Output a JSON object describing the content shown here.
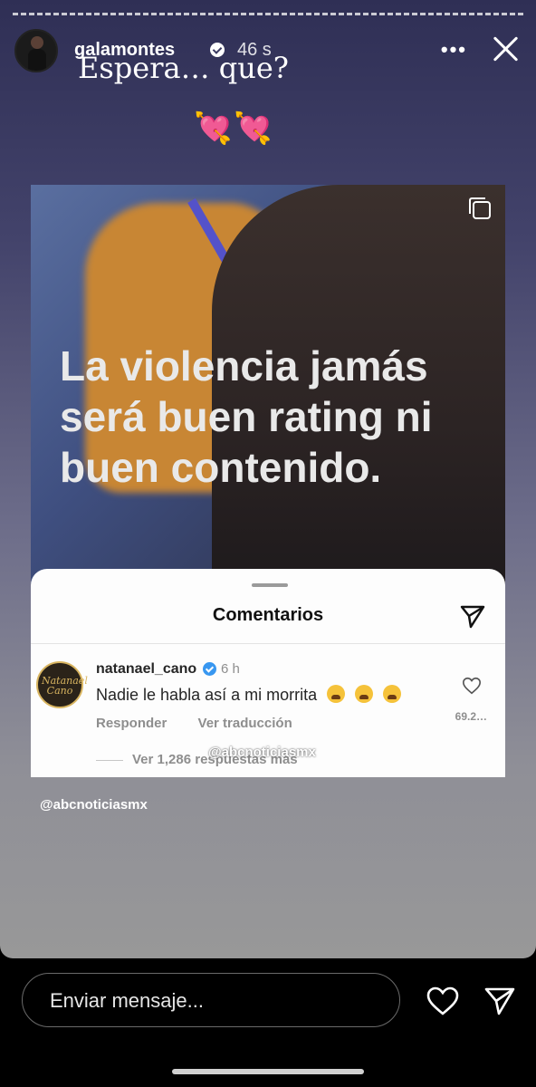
{
  "story": {
    "username": "galamontes",
    "time": "46 s",
    "caption": "Espera… que?",
    "hearts": "💘💘",
    "more_label": "•••"
  },
  "post": {
    "headline": "La violencia jamás será buen rating ni buen contenido.",
    "comments_sheet": {
      "title": "Comentarios",
      "comment": {
        "avatar_text": "Natanael Cano",
        "username": "natanael_cano",
        "time": "6 h",
        "text": "Nadie le habla así a mi morrita",
        "reply_label": "Responder",
        "translate_label": "Ver traducción",
        "likes": "69.2…"
      },
      "replies_label": "Ver 1,286 respuestas más",
      "watermark": "@abcnoticiasmx"
    }
  },
  "tag": "@abcnoticiasmx",
  "bottom_bar": {
    "message_placeholder": "Enviar mensaje..."
  },
  "colors": {
    "bg_top": "#2f2f55",
    "bg_bottom": "#989898",
    "verified_blue": "#3897f0"
  }
}
